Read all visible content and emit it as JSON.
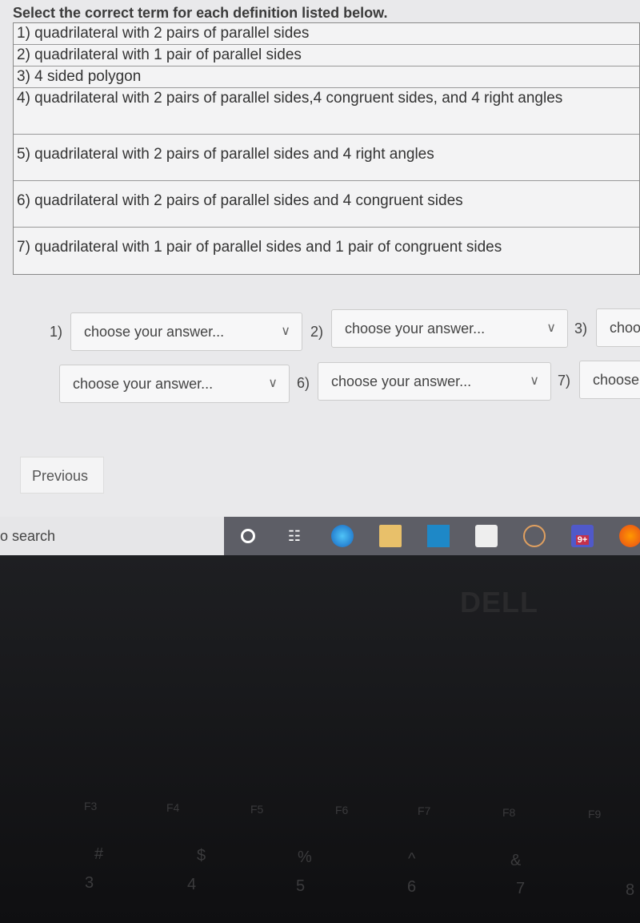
{
  "instruction": "Select the correct term for each definition listed below.",
  "definitions": [
    "1) quadrilateral with 2 pairs of parallel sides",
    "2) quadrilateral with 1 pair of parallel sides",
    "3) 4 sided polygon",
    "4) quadrilateral with 2 pairs of parallel sides,4 congruent sides, and 4 right angles",
    "5) quadrilateral with 2 pairs of parallel sides and 4 right angles",
    "6) quadrilateral with 2 pairs of parallel sides and 4 congruent sides",
    "7) quadrilateral with 1 pair of parallel sides and 1 pair of congruent sides"
  ],
  "answers": [
    {
      "label": "1)",
      "value": "choose your answer..."
    },
    {
      "label": "2)",
      "value": "choose your answer..."
    },
    {
      "label": "3)",
      "value": "choo"
    },
    {
      "label": "",
      "value": "choose your answer..."
    },
    {
      "label": "6)",
      "value": "choose your answer..."
    },
    {
      "label": "7)",
      "value": "choose"
    }
  ],
  "previous_label": "Previous",
  "taskbar": {
    "search_text": "o search",
    "badge": "9+"
  },
  "logo": "DELL",
  "keyboard": {
    "fkeys": [
      "F3",
      "F4",
      "F5",
      "F6",
      "F7",
      "F8",
      "F9"
    ],
    "symbols": [
      "#",
      "$",
      "%",
      "^",
      "&"
    ],
    "numbers": [
      "3",
      "4",
      "5",
      "6",
      "7",
      "8"
    ]
  }
}
